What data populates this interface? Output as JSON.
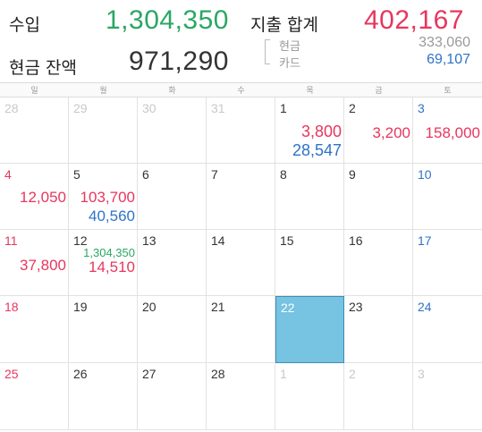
{
  "summary": {
    "income_label": "수입",
    "income_value": "1,304,350",
    "cash_balance_label": "현금 잔액",
    "cash_balance_value": "971,290",
    "expense_label": "지출 합계",
    "expense_value": "402,167",
    "cash_label": "현금",
    "cash_value": "333,060",
    "card_label": "카드",
    "card_value": "69,107"
  },
  "weekdays": [
    "일",
    "월",
    "화",
    "수",
    "목",
    "금",
    "토"
  ],
  "colors": {
    "income": "#2aa764",
    "expense": "#e8365d",
    "card": "#2e73c8",
    "today": "#76c3e2"
  },
  "weeks": [
    [
      {
        "day": "28",
        "other": true
      },
      {
        "day": "29",
        "other": true
      },
      {
        "day": "30",
        "other": true
      },
      {
        "day": "31",
        "other": true
      },
      {
        "day": "1",
        "cash": "3,800",
        "card": "28,547"
      },
      {
        "day": "2",
        "cash": "3,200"
      },
      {
        "day": "3",
        "cash": "158,000"
      }
    ],
    [
      {
        "day": "4"
      },
      {
        "day": "5"
      },
      {
        "day": "6"
      },
      {
        "day": "7"
      },
      {
        "day": "8"
      },
      {
        "day": "9"
      },
      {
        "day": "10"
      }
    ],
    [
      {
        "day": "11",
        "cash": "37,800"
      },
      {
        "day": "12",
        "income": "1,304,350",
        "cash": "14,510"
      },
      {
        "day": "13"
      },
      {
        "day": "14"
      },
      {
        "day": "15"
      },
      {
        "day": "16"
      },
      {
        "day": "17"
      }
    ],
    [
      {
        "day": "18"
      },
      {
        "day": "19"
      },
      {
        "day": "20"
      },
      {
        "day": "21"
      },
      {
        "day": "22",
        "today": true
      },
      {
        "day": "23"
      },
      {
        "day": "24"
      }
    ],
    [
      {
        "day": "25"
      },
      {
        "day": "26"
      },
      {
        "day": "27"
      },
      {
        "day": "28"
      },
      {
        "day": "1",
        "other": true
      },
      {
        "day": "2",
        "other": true
      },
      {
        "day": "3",
        "other": true
      }
    ]
  ],
  "week2_amounts": {
    "sun_cash": "12,050",
    "mon_cash": "103,700",
    "mon_card": "40,560"
  }
}
